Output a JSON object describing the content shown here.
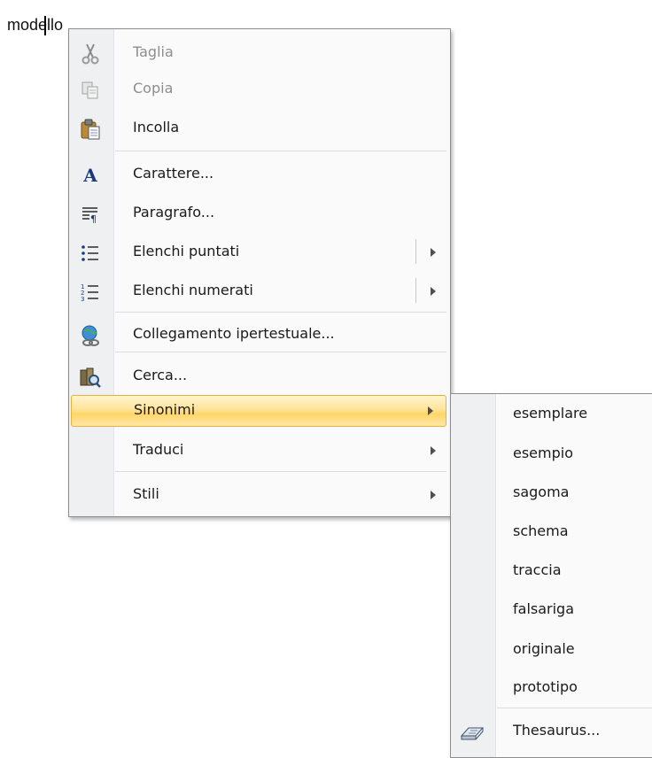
{
  "document": {
    "word": "modello"
  },
  "context_menu": {
    "items": [
      {
        "label": "Taglia",
        "icon": "scissors-icon",
        "disabled": true
      },
      {
        "label": "Copia",
        "icon": "copy-icon",
        "disabled": true
      },
      {
        "label": "Incolla",
        "icon": "paste-icon"
      },
      {
        "label": "Carattere...",
        "icon": "font-icon"
      },
      {
        "label": "Paragrafo...",
        "icon": "paragraph-icon"
      },
      {
        "label": "Elenchi puntati",
        "icon": "bullets-icon",
        "submenu": true
      },
      {
        "label": "Elenchi numerati",
        "icon": "numbering-icon",
        "submenu": true
      },
      {
        "label": "Collegamento ipertestuale...",
        "icon": "hyperlink-icon"
      },
      {
        "label": "Cerca...",
        "icon": "research-icon"
      },
      {
        "label": "Sinonimi",
        "submenu": true,
        "highlighted": true
      },
      {
        "label": "Traduci",
        "submenu": true
      },
      {
        "label": "Stili",
        "submenu": true
      }
    ]
  },
  "synonyms_submenu": {
    "items": [
      "esemplare",
      "esempio",
      "sagoma",
      "schema",
      "traccia",
      "falsariga",
      "originale",
      "prototipo"
    ],
    "thesaurus_label": "Thesaurus...",
    "thesaurus_icon": "thesaurus-book-icon"
  },
  "colors": {
    "highlight": "#ffd667",
    "highlight_border": "#e3b33b",
    "menu_bg": "#fafafa",
    "icon_column": "#eef0f2"
  }
}
